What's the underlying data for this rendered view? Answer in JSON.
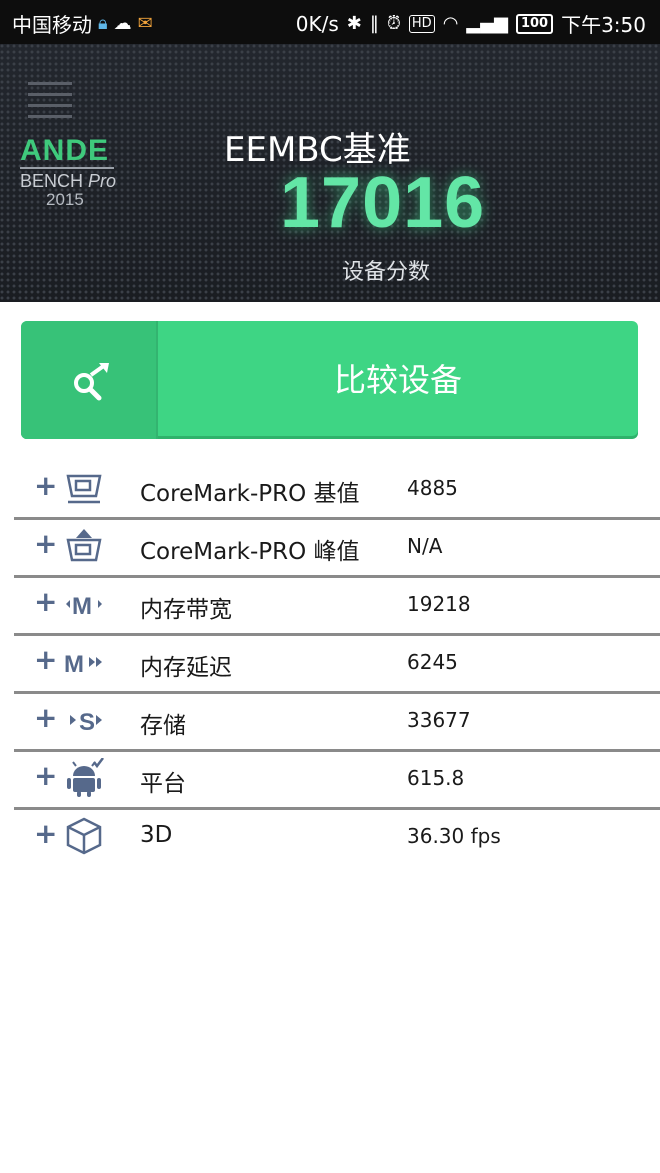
{
  "status_bar": {
    "carrier": "中国移动",
    "net_speed": "0K/s",
    "battery": "100",
    "time": "下午3:50",
    "icons": [
      "lock-icon",
      "wechat-icon",
      "mail-icon",
      "bluetooth-icon",
      "vibrate-icon",
      "alarm-icon",
      "hd-icon",
      "wifi-icon",
      "signal-icon"
    ]
  },
  "header": {
    "title": "EEMBC基准",
    "score": "17016",
    "score_label": "设备分数",
    "logo": {
      "ande": "ANDE",
      "bench": "BENCH",
      "pro": "Pro",
      "year": "2015"
    }
  },
  "compare_button": {
    "label": "比较设备",
    "icon": "compare-search-icon"
  },
  "benchmarks": [
    {
      "label": "CoreMark-PRO 基值",
      "value": "4885",
      "icon": "coremark-base-icon"
    },
    {
      "label": "CoreMark-PRO 峰值",
      "value": "N/A",
      "icon": "coremark-peak-icon"
    },
    {
      "label": "内存带宽",
      "value": "19218",
      "icon": "memory-bandwidth-icon"
    },
    {
      "label": "内存延迟",
      "value": "6245",
      "icon": "memory-latency-icon"
    },
    {
      "label": "存储",
      "value": "33677",
      "icon": "storage-icon"
    },
    {
      "label": "平台",
      "value": "615.8",
      "icon": "android-platform-icon"
    },
    {
      "label": "3D",
      "value": "36.30 fps",
      "icon": "cube-3d-icon"
    }
  ],
  "expand_symbol": "+",
  "colors": {
    "accent_green": "#3ed584",
    "score_green": "#63e6a6",
    "icon_blue": "#56698b",
    "header_bg": "#1e2127"
  }
}
